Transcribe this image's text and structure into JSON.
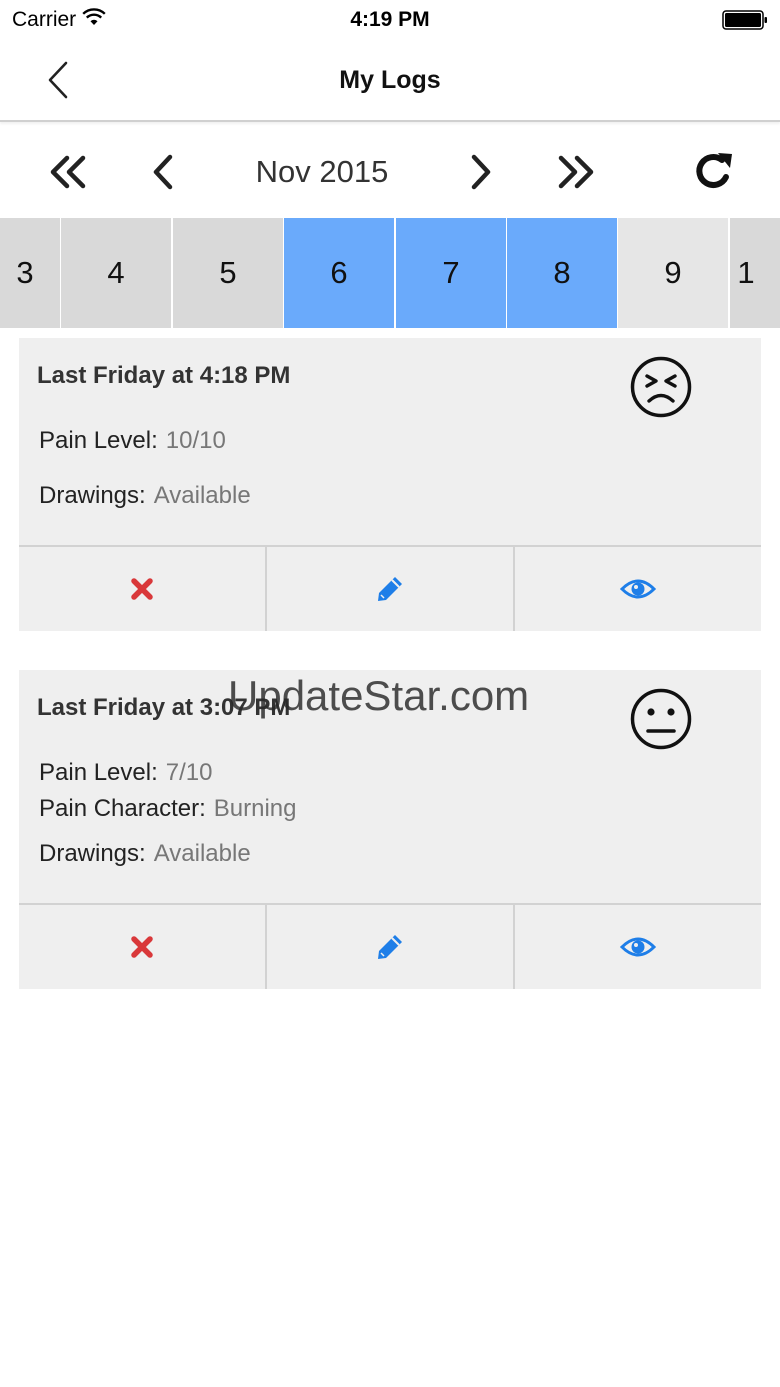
{
  "status_bar": {
    "carrier": "Carrier",
    "time": "4:19 PM"
  },
  "nav": {
    "title": "My Logs",
    "back_icon": "chevron-left-icon"
  },
  "month_nav": {
    "label": "Nov 2015",
    "refresh_icon": "refresh-icon"
  },
  "days": [
    "3",
    "4",
    "5",
    "6",
    "7",
    "8",
    "9",
    "1"
  ],
  "selected_days": [
    "6",
    "7",
    "8"
  ],
  "colors": {
    "selected_day": "#6aaafb",
    "delete": "#d9383a",
    "accent": "#1e7ee8"
  },
  "logs": [
    {
      "title": "Last Friday at 4:18 PM",
      "face_icon": "pain-face-icon",
      "pain_level_label": "Pain Level:",
      "pain_level": "10/10",
      "drawings_label": "Drawings:",
      "drawings": "Available"
    },
    {
      "title": "Last Friday at 3:07 PM",
      "face_icon": "neutral-face-icon",
      "pain_level_label": "Pain Level:",
      "pain_level": "7/10",
      "pain_character_label": "Pain Character:",
      "pain_character": "Burning",
      "drawings_label": "Drawings:",
      "drawings": "Available"
    }
  ],
  "watermark": "UpdateStar.com"
}
